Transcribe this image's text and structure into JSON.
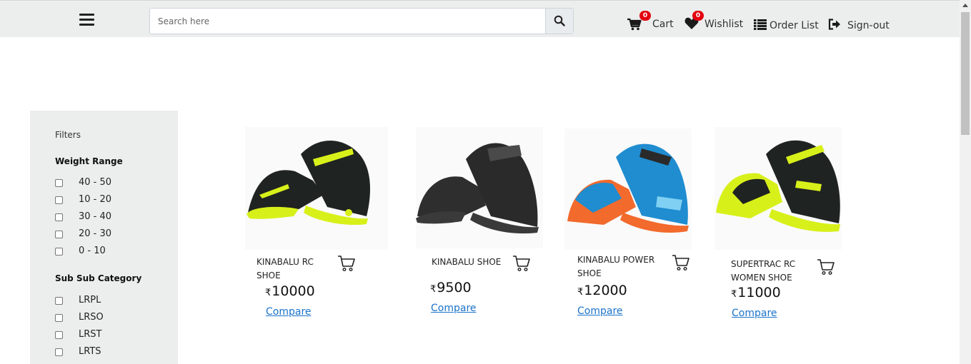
{
  "header": {
    "search_placeholder": "Search here",
    "cart_label": "Cart",
    "cart_count": "0",
    "wishlist_label": "Wishlist",
    "wishlist_count": "0",
    "orderlist_label": "Order List",
    "signout_label": "Sign-out"
  },
  "sidebar": {
    "title": "Filters",
    "weight_title": "Weight Range",
    "weight_options": [
      "40 - 50",
      "10 - 20",
      "30 - 40",
      "20 - 30",
      "0 - 10"
    ],
    "category_title": "Sub Sub Category",
    "category_options": [
      "LRPL",
      "LRSO",
      "LRST",
      "LRTS"
    ]
  },
  "products": [
    {
      "name": "KINABALU RC SHOE",
      "currency": "₹",
      "price": "10000",
      "compare": "Compare",
      "colors": {
        "upper": "#1f2321",
        "accent": "#d8f01a",
        "sole": "#d8f01a"
      }
    },
    {
      "name": "KINABALU SHOE",
      "currency": "₹",
      "price": "9500",
      "compare": "Compare",
      "colors": {
        "upper": "#2e2e2e",
        "accent": "#4a4a4a",
        "sole": "#3a3a3a"
      }
    },
    {
      "name": "KINABALU POWER SHOE",
      "currency": "₹",
      "price": "12000",
      "compare": "Compare",
      "colors": {
        "upper": "#1f8dd0",
        "accent": "#f26a2c",
        "sole": "#f26a2c"
      }
    },
    {
      "name": "SUPERTRAC RC WOMEN SHOE",
      "currency": "₹",
      "price": "11000",
      "compare": "Compare",
      "colors": {
        "upper": "#1f2321",
        "accent": "#d8f01a",
        "sole": "#d8f01a"
      }
    }
  ],
  "colors": {
    "header_bg": "#eceeee",
    "link": "#1a73c9",
    "badge": "#e3000f"
  }
}
